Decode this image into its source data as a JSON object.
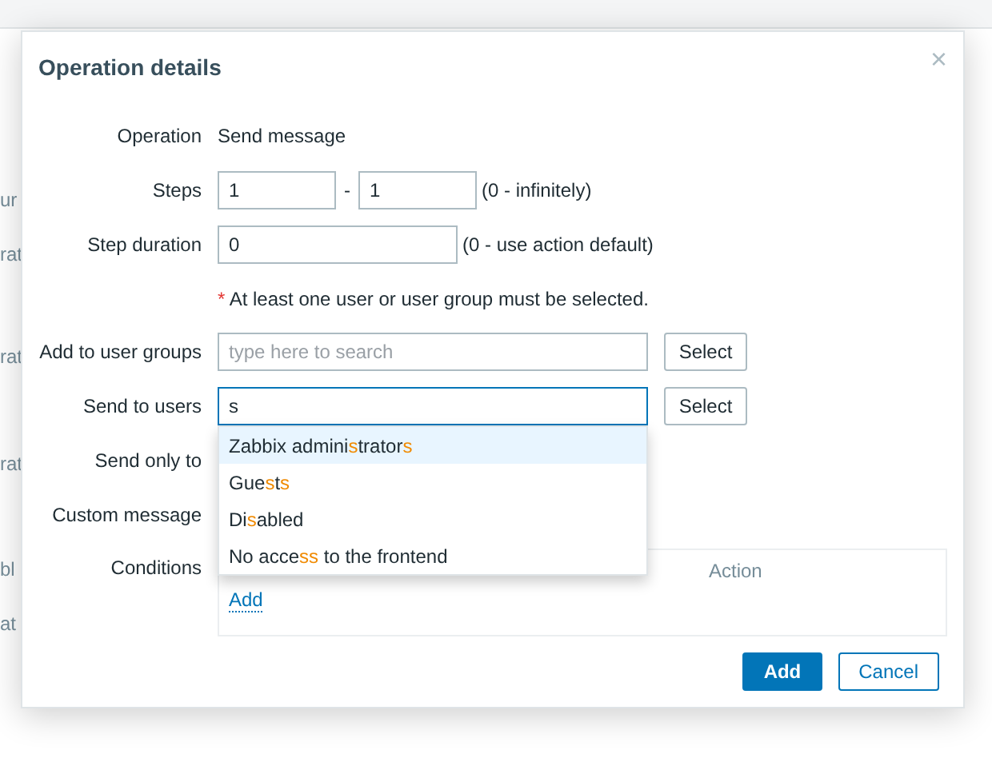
{
  "background_fragments": [
    "ur",
    "rat",
    "rat",
    "rat",
    "bl",
    "at"
  ],
  "dialog": {
    "title": "Operation details",
    "close": "×"
  },
  "operation": {
    "label": "Operation",
    "value": "Send message"
  },
  "steps": {
    "label": "Steps",
    "from": "1",
    "separator": "-",
    "to": "1",
    "hint": "(0 - infinitely)"
  },
  "step_duration": {
    "label": "Step duration",
    "value": "0",
    "hint": "(0 - use action default)"
  },
  "note": {
    "mark": "*",
    "text": "At least one user or user group must be selected."
  },
  "user_groups": {
    "label": "Add to user groups",
    "placeholder": "type here to search",
    "button": "Select"
  },
  "users": {
    "label": "Send to users",
    "value": "s",
    "button": "Select",
    "focused": true
  },
  "suggestions": [
    {
      "selected": true,
      "parts": [
        {
          "text": "Zabbix admini",
          "match": false
        },
        {
          "text": "s",
          "match": true
        },
        {
          "text": "trator",
          "match": false
        },
        {
          "text": "s",
          "match": true
        }
      ]
    },
    {
      "selected": false,
      "parts": [
        {
          "text": "Gue",
          "match": false
        },
        {
          "text": "s",
          "match": true
        },
        {
          "text": "t",
          "match": false
        },
        {
          "text": "s",
          "match": true
        }
      ]
    },
    {
      "selected": false,
      "parts": [
        {
          "text": "Di",
          "match": false
        },
        {
          "text": "s",
          "match": true
        },
        {
          "text": "abled",
          "match": false
        }
      ]
    },
    {
      "selected": false,
      "parts": [
        {
          "text": "No acce",
          "match": false
        },
        {
          "text": "ss",
          "match": true
        },
        {
          "text": " to the frontend",
          "match": false
        }
      ]
    }
  ],
  "send_only_to": {
    "label": "Send only to"
  },
  "custom_message": {
    "label": "Custom message"
  },
  "conditions": {
    "label": "Conditions",
    "columns": [
      "Action"
    ],
    "add_link": "Add"
  },
  "buttons": [
    {
      "label": "Add",
      "kind": "primary"
    },
    {
      "label": "Cancel",
      "kind": "secondary"
    }
  ]
}
